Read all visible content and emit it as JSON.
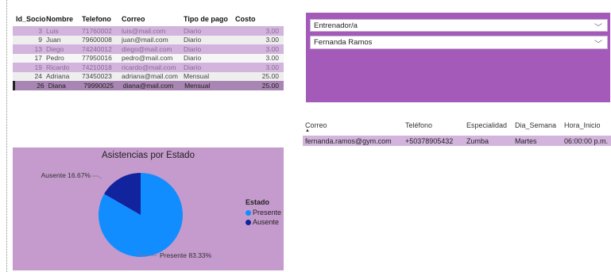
{
  "members_table": {
    "headers": {
      "id": "Id_Socio",
      "nombre": "Nombre",
      "telefono": "Telefono",
      "correo": "Correo",
      "tipo": "Tipo de pago",
      "costo": "Costo"
    },
    "rows": [
      {
        "id": "3",
        "nombre": "Luis",
        "telefono": "71760002",
        "correo": "luis@mail.com",
        "tipo": "Diario",
        "costo": "3,00",
        "style": "shade"
      },
      {
        "id": "9",
        "nombre": "Juan",
        "telefono": "79600008",
        "correo": "juan@mail.com",
        "tipo": "Diario",
        "costo": "3.00",
        "style": "light"
      },
      {
        "id": "13",
        "nombre": "Diego",
        "telefono": "74240012",
        "correo": "diego@mail.com",
        "tipo": "Diario",
        "costo": "3.00",
        "style": "shade"
      },
      {
        "id": "17",
        "nombre": "Pedro",
        "telefono": "77950016",
        "correo": "pedro@mail.com",
        "tipo": "Diario",
        "costo": "3.00",
        "style": "white"
      },
      {
        "id": "19",
        "nombre": "Ricardo",
        "telefono": "74210018",
        "correo": "ricardo@mail.com",
        "tipo": "Diario",
        "costo": "3.00",
        "style": "shade"
      },
      {
        "id": "24",
        "nombre": "Adriana",
        "telefono": "73450023",
        "correo": "adriana@mail.com",
        "tipo": "Mensual",
        "costo": "25.00",
        "style": "light"
      },
      {
        "id": "26",
        "nombre": "Diana",
        "telefono": "79990025",
        "correo": "diana@mail.com",
        "tipo": "Mensual",
        "costo": "25.00",
        "style": "sel"
      }
    ]
  },
  "slicers": {
    "field": "Entrenador/a",
    "selected": "Fernanda Ramos"
  },
  "trainer_table": {
    "headers": {
      "correo": "Correo",
      "telefono": "Teléfono",
      "especialidad": "Especialidad",
      "dia": "Dia_Semana",
      "hora": "Hora_Inicio"
    },
    "row": {
      "correo": "fernanda.ramos@gym.com",
      "telefono": "+50378905432",
      "especialidad": "Zumba",
      "dia": "Martes",
      "hora": "06:00:00 p.m."
    }
  },
  "pie": {
    "title": "Asistencias por Estado",
    "legend_title": "Estado",
    "label_ausente": "Ausente 16.67%",
    "label_presente": "Presente 83.33%"
  },
  "chart_data": {
    "type": "pie",
    "title": "Asistencias por Estado",
    "legend_title": "Estado",
    "legend_position": "right",
    "slices": [
      {
        "name": "Presente",
        "value": 83.33,
        "color": "#118dff"
      },
      {
        "name": "Ausente",
        "value": 16.67,
        "color": "#12239e"
      }
    ]
  }
}
